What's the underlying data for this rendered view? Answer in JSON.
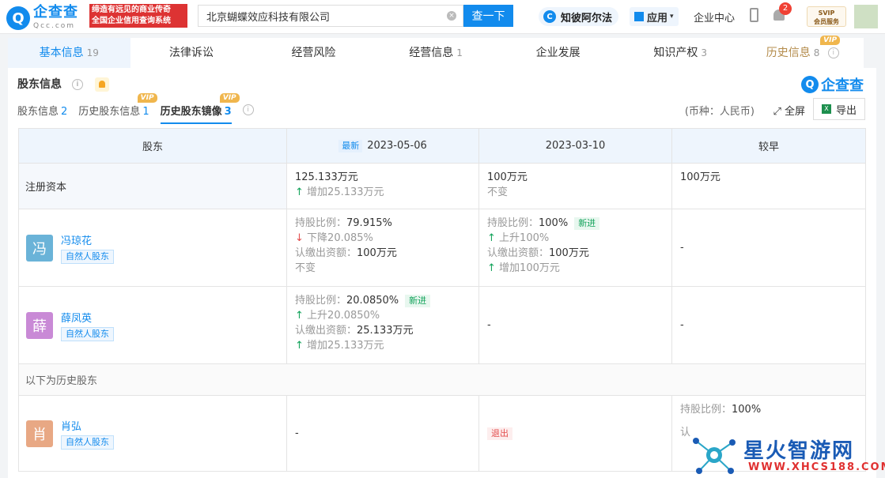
{
  "header": {
    "logo_glyph": "Q",
    "logo_name": "企查查",
    "logo_domain": "Qcc.com",
    "slogan_line1": "缔造有远见的商业传奇",
    "slogan_line2": "全国企业信用查询系统",
    "search_value": "北京蝴蝶效应科技有限公司",
    "search_button": "查一下",
    "zhibo_label": "知彼阿尔法",
    "apps_label": "应用",
    "enterprise_center": "企业中心",
    "notification_count": "2",
    "svip_line1": "SVIP",
    "svip_line2": "会员服务"
  },
  "tabs": [
    {
      "label": "基本信息",
      "count": "19"
    },
    {
      "label": "法律诉讼",
      "count": ""
    },
    {
      "label": "经营风险",
      "count": ""
    },
    {
      "label": "经营信息",
      "count": "1"
    },
    {
      "label": "企业发展",
      "count": ""
    },
    {
      "label": "知识产权",
      "count": "3"
    },
    {
      "label": "历史信息",
      "count": "8"
    }
  ],
  "vip_label": "VIP",
  "section": {
    "title": "股东信息",
    "brand": "企查查",
    "subtabs": [
      {
        "label": "股东信息",
        "count": "2"
      },
      {
        "label": "历史股东信息",
        "count": "1"
      },
      {
        "label": "历史股东镜像",
        "count": "3"
      }
    ],
    "currency": "(币种：人民币)",
    "fullscreen": "全屏",
    "export": "导出"
  },
  "table": {
    "col_shareholder": "股东",
    "newest_tag": "最新",
    "date1": "2023-05-06",
    "date2": "2023-03-10",
    "date3": "较早",
    "capital_label": "注册资本",
    "capital": {
      "c1_value": "125.133万元",
      "c1_change": "增加25.133万元",
      "c2_value": "100万元",
      "c2_change": "不变",
      "c3_value": "100万元"
    },
    "history_label": "以下为历史股东",
    "dash": "-",
    "shareholders": [
      {
        "avatar": "冯",
        "name": "冯琼花",
        "tag": "自然人股东",
        "avatar_color": "#6ab3d8",
        "c1": {
          "ratio_label": "持股比例：",
          "ratio": "79.915%",
          "ratio_change": "下降20.085%",
          "paid_label": "认缴出资额：",
          "paid": "100万元",
          "paid_change": "不变"
        },
        "c2": {
          "ratio_label": "持股比例：",
          "ratio": "100%",
          "new_tag": "新进",
          "ratio_change": "上升100%",
          "paid_label": "认缴出资额：",
          "paid": "100万元",
          "paid_change": "增加100万元"
        }
      },
      {
        "avatar": "薛",
        "name": "薛凤英",
        "tag": "自然人股东",
        "avatar_color": "#c98ad6",
        "c1": {
          "ratio_label": "持股比例：",
          "ratio": "20.0850%",
          "new_tag": "新进",
          "ratio_change": "上升20.0850%",
          "paid_label": "认缴出资额：",
          "paid": "25.133万元",
          "paid_change": "增加25.133万元"
        }
      },
      {
        "avatar": "肖",
        "name": "肖弘",
        "tag": "自然人股东",
        "avatar_color": "#e8a884",
        "c2_exit": "退出",
        "c3": {
          "ratio_label": "持股比例：",
          "ratio": "100%",
          "paid_label": "认"
        }
      }
    ]
  },
  "watermark": {
    "title": "星火智游网",
    "url": "WWW.XHCS188.COM"
  }
}
